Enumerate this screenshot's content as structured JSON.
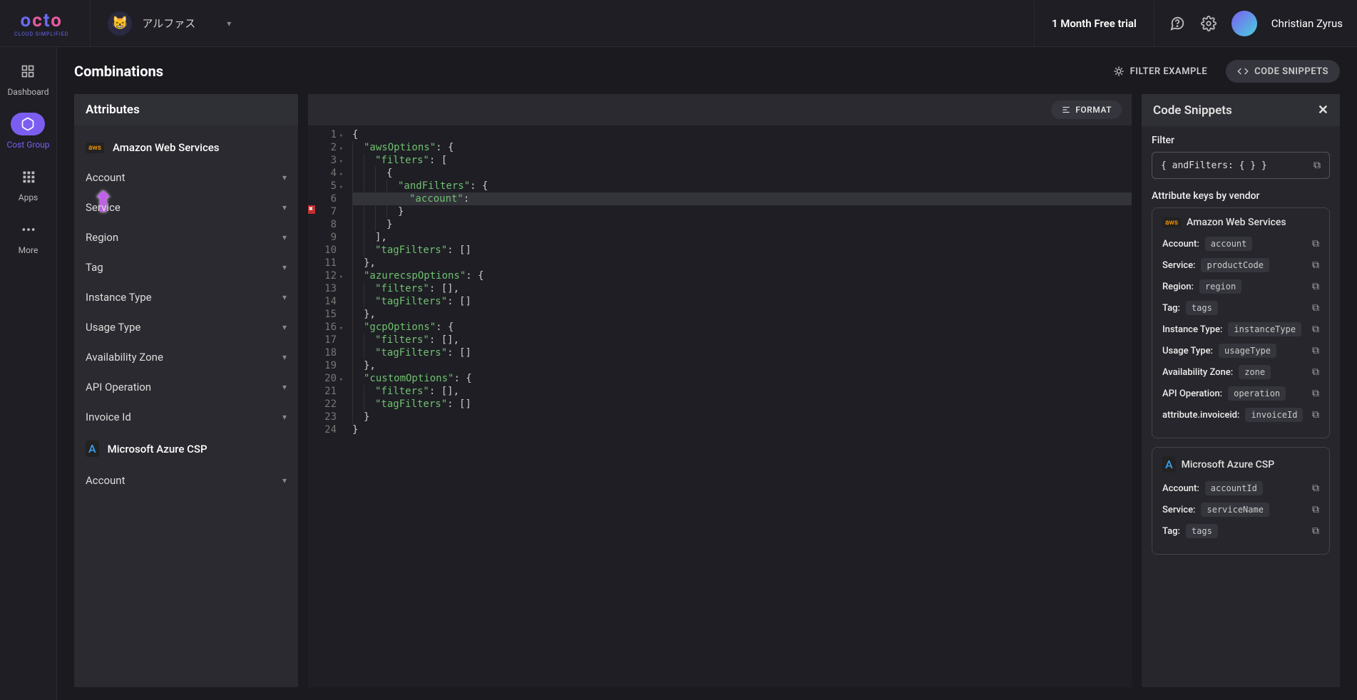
{
  "brand": {
    "name": "octo",
    "sub": "CLOUD SIMPLIFIED"
  },
  "org": {
    "name": "アルファス",
    "avatar_emoji": "😸"
  },
  "trial_label": "1 Month Free trial",
  "user": {
    "name": "Christian Zyrus"
  },
  "nav": [
    {
      "label": "Dashboard"
    },
    {
      "label": "Cost Group"
    },
    {
      "label": "Apps"
    },
    {
      "label": "More"
    }
  ],
  "page_title": "Combinations",
  "header_buttons": {
    "filter_example": "FILTER EXAMPLE",
    "code_snippets": "CODE SNIPPETS"
  },
  "attributes_panel": {
    "title": "Attributes",
    "vendors": [
      {
        "name": "Amazon Web Services",
        "badge": "aws",
        "items": [
          "Account",
          "Service",
          "Region",
          "Tag",
          "Instance Type",
          "Usage Type",
          "Availability Zone",
          "API Operation",
          "Invoice Id"
        ]
      },
      {
        "name": "Microsoft Azure CSP",
        "badge": "A",
        "items": [
          "Account"
        ]
      }
    ]
  },
  "editor": {
    "format_label": "FORMAT",
    "lines": [
      {
        "n": 1,
        "fold": true,
        "txt": "{"
      },
      {
        "n": 2,
        "fold": true,
        "txt": "  \"awsOptions\": {"
      },
      {
        "n": 3,
        "fold": true,
        "txt": "    \"filters\": ["
      },
      {
        "n": 4,
        "fold": true,
        "txt": "      {"
      },
      {
        "n": 5,
        "fold": true,
        "txt": "        \"andFilters\": {"
      },
      {
        "n": 6,
        "hl": true,
        "txt": "          \"account\":"
      },
      {
        "n": 7,
        "err": true,
        "txt": "        }"
      },
      {
        "n": 8,
        "txt": "      }"
      },
      {
        "n": 9,
        "txt": "    ],"
      },
      {
        "n": 10,
        "txt": "    \"tagFilters\": []"
      },
      {
        "n": 11,
        "txt": "  },"
      },
      {
        "n": 12,
        "fold": true,
        "txt": "  \"azurecspOptions\": {"
      },
      {
        "n": 13,
        "txt": "    \"filters\": [],"
      },
      {
        "n": 14,
        "txt": "    \"tagFilters\": []"
      },
      {
        "n": 15,
        "txt": "  },"
      },
      {
        "n": 16,
        "fold": true,
        "txt": "  \"gcpOptions\": {"
      },
      {
        "n": 17,
        "txt": "    \"filters\": [],"
      },
      {
        "n": 18,
        "txt": "    \"tagFilters\": []"
      },
      {
        "n": 19,
        "txt": "  },"
      },
      {
        "n": 20,
        "fold": true,
        "txt": "  \"customOptions\": {"
      },
      {
        "n": 21,
        "txt": "    \"filters\": [],"
      },
      {
        "n": 22,
        "txt": "    \"tagFilters\": []"
      },
      {
        "n": 23,
        "txt": "  }"
      },
      {
        "n": 24,
        "txt": "}"
      }
    ]
  },
  "snippets": {
    "title": "Code Snippets",
    "filter_label": "Filter",
    "filter_code": "{ andFilters: { } }",
    "attr_keys_label": "Attribute keys by vendor",
    "vendors": [
      {
        "name": "Amazon Web Services",
        "badge": "aws",
        "attrs": [
          {
            "label": "Account:",
            "key": "account"
          },
          {
            "label": "Service:",
            "key": "productCode"
          },
          {
            "label": "Region:",
            "key": "region"
          },
          {
            "label": "Tag:",
            "key": "tags"
          },
          {
            "label": "Instance Type:",
            "key": "instanceType"
          },
          {
            "label": "Usage Type:",
            "key": "usageType"
          },
          {
            "label": "Availability Zone:",
            "key": "zone"
          },
          {
            "label": "API Operation:",
            "key": "operation"
          },
          {
            "label": "attribute.invoiceid:",
            "key": "invoiceId"
          }
        ]
      },
      {
        "name": "Microsoft Azure CSP",
        "badge": "A",
        "attrs": [
          {
            "label": "Account:",
            "key": "accountId"
          },
          {
            "label": "Service:",
            "key": "serviceName"
          },
          {
            "label": "Tag:",
            "key": "tags"
          }
        ]
      }
    ]
  }
}
